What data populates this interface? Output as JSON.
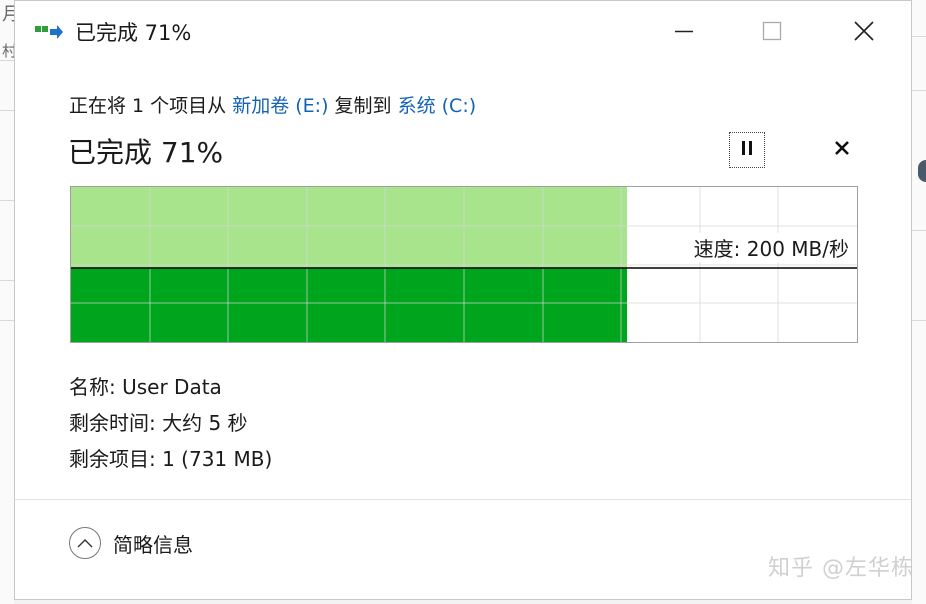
{
  "window": {
    "title": "已完成 71%"
  },
  "titlebar": {
    "minimize_icon": "minimize-icon",
    "maximize_icon": "maximize-icon",
    "close_icon": "close-icon"
  },
  "operation": {
    "prefix": "正在将 1 个项目从 ",
    "source": "新加卷 (E:)",
    "middle": " 复制到 ",
    "destination": "系统 (C:)"
  },
  "progress": {
    "label": "已完成 71%",
    "percent": 71,
    "pause_icon": "pause-icon",
    "cancel_icon": "close-icon"
  },
  "speed_graph": {
    "speed_label": "速度: 200 MB/秒",
    "speed_line_fraction": 0.52,
    "colors": {
      "completed": "#00a51e",
      "completed_light": "#a8e48c",
      "grid": "#d6d6d6",
      "speed_line": "#000000"
    }
  },
  "details": {
    "name": "名称: User Data",
    "time_remaining": "剩余时间: 大约 5 秒",
    "items_remaining": "剩余项目: 1 (731 MB)"
  },
  "footer": {
    "toggle_label": "简略信息",
    "toggle_icon": "chevron-up-icon"
  },
  "watermark": "知乎 @左华栋",
  "colors": {
    "link": "#1463b4"
  }
}
